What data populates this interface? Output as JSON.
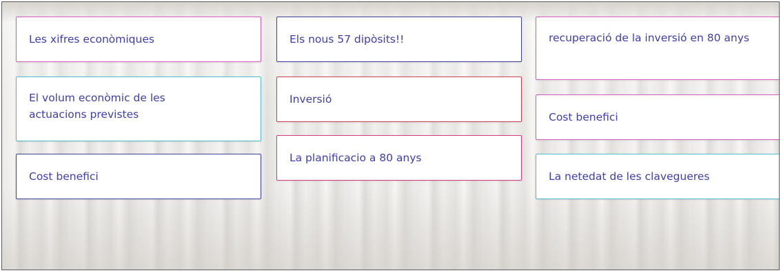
{
  "cards": [
    {
      "label": "Les xifres econòmiques",
      "border_color": "#d45bc2"
    },
    {
      "label": "El volum econòmic de les actuacions previstes",
      "border_color": "#4bb8cc"
    },
    {
      "label": "Cost benefici",
      "border_color": "#3a3f9a"
    },
    {
      "label": "Els nous 57 dipòsits!!",
      "border_color": "#3a3f9a"
    },
    {
      "label": "Inversió",
      "border_color": "#c8404f"
    },
    {
      "label": "La planificacio a 80 anys",
      "border_color": "#d4387e"
    },
    {
      "label": "recuperació de la inversió en 80 anys",
      "border_color": "#d45bc2"
    },
    {
      "label": "Cost benefici",
      "border_color": "#d45bc2"
    },
    {
      "label": "La netedat de les clavegueres",
      "border_color": "#4bb8cc"
    }
  ],
  "text_color": "#3d3db5"
}
